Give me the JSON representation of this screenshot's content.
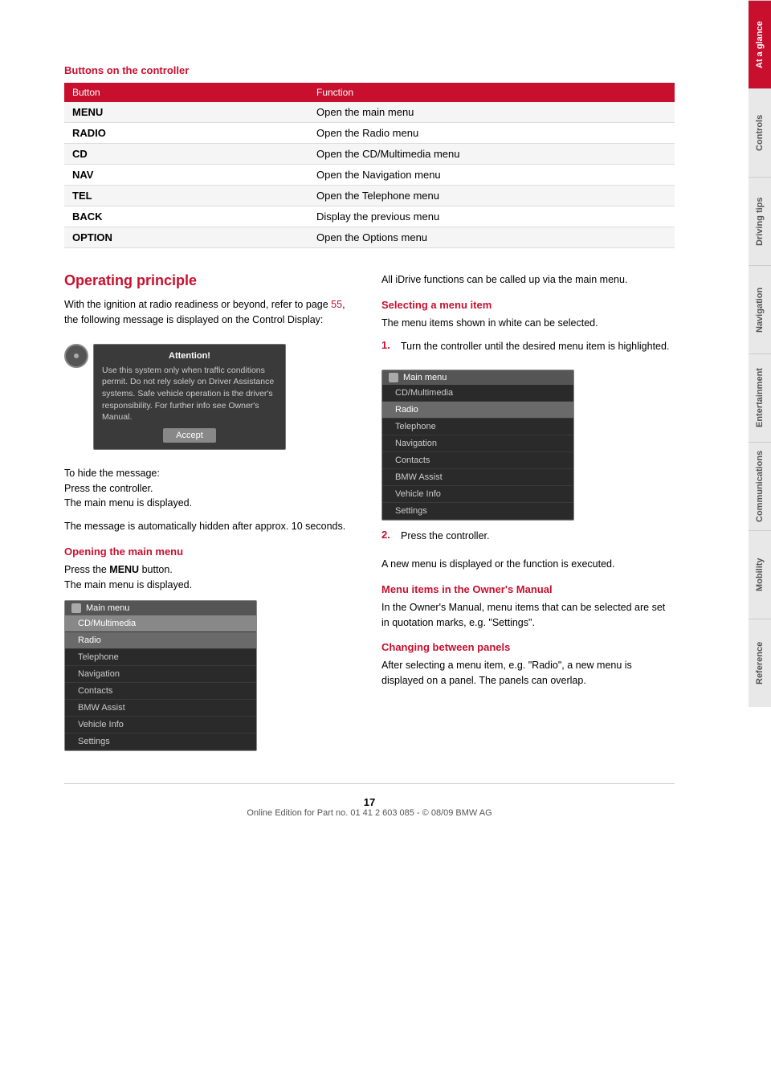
{
  "page": {
    "number": "17",
    "footer_text": "Online Edition for Part no. 01 41 2 603 085 - © 08/09 BMW AG"
  },
  "sidebar": {
    "tabs": [
      {
        "label": "At a glance",
        "active": true
      },
      {
        "label": "Controls",
        "active": false
      },
      {
        "label": "Driving tips",
        "active": false
      },
      {
        "label": "Navigation",
        "active": false
      },
      {
        "label": "Entertainment",
        "active": false
      },
      {
        "label": "Communications",
        "active": false
      },
      {
        "label": "Mobility",
        "active": false
      },
      {
        "label": "Reference",
        "active": false
      }
    ]
  },
  "buttons_section": {
    "heading": "Buttons on the controller",
    "table": {
      "col1_header": "Button",
      "col2_header": "Function",
      "rows": [
        {
          "button": "MENU",
          "function": "Open the main menu"
        },
        {
          "button": "RADIO",
          "function": "Open the Radio menu"
        },
        {
          "button": "CD",
          "function": "Open the CD/Multimedia menu"
        },
        {
          "button": "NAV",
          "function": "Open the Navigation menu"
        },
        {
          "button": "TEL",
          "function": "Open the Telephone menu"
        },
        {
          "button": "BACK",
          "function": "Display the previous menu"
        },
        {
          "button": "OPTION",
          "function": "Open the Options menu"
        }
      ]
    }
  },
  "operating_principle": {
    "title": "Operating principle",
    "intro_text": "With the ignition at radio readiness or beyond, refer to page ",
    "page_ref": "55",
    "intro_text2": ", the following message is displayed on the Control Display:",
    "attention_box": {
      "title": "Attention!",
      "text": "Use this system only when traffic conditions permit. Do not rely solely on Driver Assistance systems. Safe vehicle operation is the driver's responsibility. For further info see Owner's Manual.",
      "accept_label": "Accept"
    },
    "hide_message_text": "To hide the message:\nPress the controller.\nThe main menu is displayed.",
    "auto_hide_text": "The message is automatically hidden after approx. 10 seconds.",
    "opening_main_menu": {
      "heading": "Opening the main menu",
      "text_before": "Press the ",
      "bold_word": "MENU",
      "text_after": " button.\nThe main menu is displayed."
    },
    "screen1": {
      "title": "Main menu",
      "items": [
        {
          "label": "CD/Multimedia",
          "state": "highlighted"
        },
        {
          "label": "Radio",
          "state": "selected"
        },
        {
          "label": "Telephone",
          "state": "normal"
        },
        {
          "label": "Navigation",
          "state": "normal"
        },
        {
          "label": "Contacts",
          "state": "normal"
        },
        {
          "label": "BMW Assist",
          "state": "normal"
        },
        {
          "label": "Vehicle Info",
          "state": "normal"
        },
        {
          "label": "Settings",
          "state": "normal"
        }
      ]
    },
    "right_col": {
      "intro_text": "All iDrive functions can be called up via the main menu.",
      "selecting_menu_item": {
        "heading": "Selecting a menu item",
        "text": "The menu items shown in white can be selected.",
        "step1": "Turn the controller until the desired menu item is highlighted."
      },
      "screen2": {
        "title": "Main menu",
        "items": [
          {
            "label": "CD/Multimedia",
            "state": "normal"
          },
          {
            "label": "Radio",
            "state": "selected"
          },
          {
            "label": "Telephone",
            "state": "normal"
          },
          {
            "label": "Navigation",
            "state": "normal"
          },
          {
            "label": "Contacts",
            "state": "normal"
          },
          {
            "label": "BMW Assist",
            "state": "normal"
          },
          {
            "label": "Vehicle Info",
            "state": "normal"
          },
          {
            "label": "Settings",
            "state": "normal"
          }
        ]
      },
      "step2": "Press the controller.",
      "step2_result": "A new menu is displayed or the function is executed.",
      "menu_items_owners_manual": {
        "heading": "Menu items in the Owner's Manual",
        "text": "In the Owner's Manual, menu items that can be selected are set in quotation marks, e.g. \"Settings\"."
      },
      "changing_between_panels": {
        "heading": "Changing between panels",
        "text": "After selecting a menu item, e.g. \"Radio\", a new menu is displayed on a panel. The panels can overlap."
      }
    }
  }
}
